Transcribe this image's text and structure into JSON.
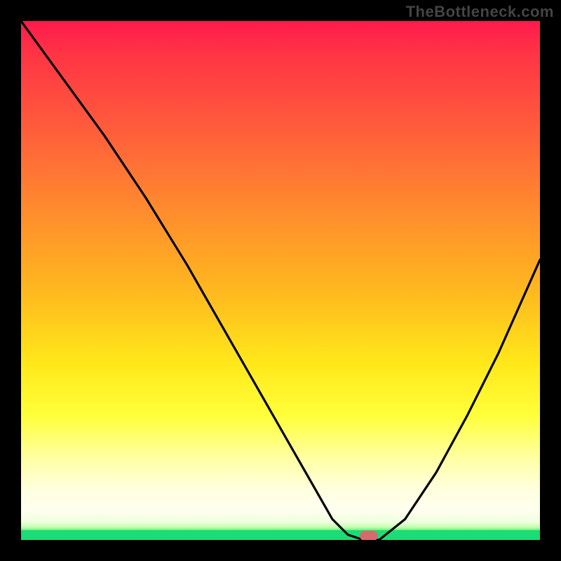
{
  "watermark": "TheBottleneck.com",
  "chart_data": {
    "type": "line",
    "title": "",
    "xlabel": "",
    "ylabel": "",
    "xlim": [
      0,
      100
    ],
    "ylim": [
      0,
      100
    ],
    "x": [
      0,
      8,
      16,
      24,
      32,
      40,
      48,
      56,
      60,
      63,
      66,
      69,
      74,
      80,
      86,
      92,
      100
    ],
    "values": [
      100,
      89,
      78,
      66,
      53,
      39,
      25,
      11,
      4,
      1,
      0,
      0,
      4,
      13,
      24,
      36,
      54
    ],
    "optimal_marker": {
      "x": 67,
      "y": 0.8
    },
    "gradient_stops": [
      {
        "pos": 0.0,
        "color": "#ff1a4d"
      },
      {
        "pos": 0.36,
        "color": "#ff8a2e"
      },
      {
        "pos": 0.66,
        "color": "#ffe81a"
      },
      {
        "pos": 0.9,
        "color": "#ffffdd"
      },
      {
        "pos": 0.98,
        "color": "#63f07a"
      },
      {
        "pos": 1.0,
        "color": "#18dd74"
      }
    ]
  }
}
